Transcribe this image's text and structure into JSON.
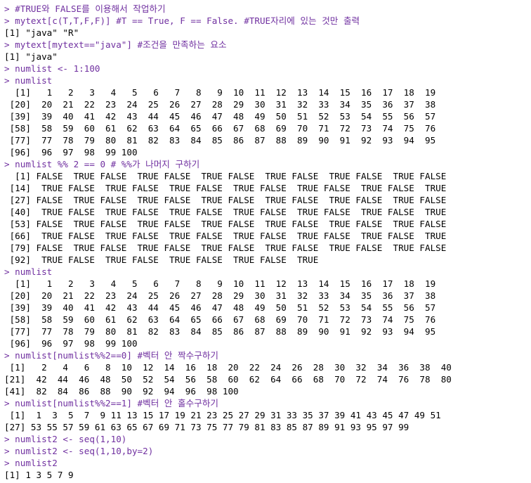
{
  "colors": {
    "input": "#7030a0",
    "output": "#000000",
    "background": "#ffffff"
  },
  "console": {
    "lines": [
      {
        "type": "input",
        "text": "> #TRUE와 FALSE를 이용해서 작업하기"
      },
      {
        "type": "input",
        "text": "> mytext[c(T,T,F,F)] #T == True, F == False. #TRUE자리에 있는 것만 출력"
      },
      {
        "type": "output",
        "text": "[1] \"java\" \"R\""
      },
      {
        "type": "input",
        "text": "> mytext[mytext==\"java\"] #조건을 만족하는 요소"
      },
      {
        "type": "output",
        "text": "[1] \"java\""
      },
      {
        "type": "input",
        "text": "> numlist <- 1:100"
      },
      {
        "type": "input",
        "text": "> numlist"
      },
      {
        "type": "output",
        "text": "  [1]   1   2   3   4   5   6   7   8   9  10  11  12  13  14  15  16  17  18  19"
      },
      {
        "type": "output",
        "text": " [20]  20  21  22  23  24  25  26  27  28  29  30  31  32  33  34  35  36  37  38"
      },
      {
        "type": "output",
        "text": " [39]  39  40  41  42  43  44  45  46  47  48  49  50  51  52  53  54  55  56  57"
      },
      {
        "type": "output",
        "text": " [58]  58  59  60  61  62  63  64  65  66  67  68  69  70  71  72  73  74  75  76"
      },
      {
        "type": "output",
        "text": " [77]  77  78  79  80  81  82  83  84  85  86  87  88  89  90  91  92  93  94  95"
      },
      {
        "type": "output",
        "text": " [96]  96  97  98  99 100"
      },
      {
        "type": "input",
        "text": "> numlist %% 2 == 0 # %%가 나머지 구하기"
      },
      {
        "type": "output",
        "text": "  [1] FALSE  TRUE FALSE  TRUE FALSE  TRUE FALSE  TRUE FALSE  TRUE FALSE  TRUE FALSE"
      },
      {
        "type": "output",
        "text": " [14]  TRUE FALSE  TRUE FALSE  TRUE FALSE  TRUE FALSE  TRUE FALSE  TRUE FALSE  TRUE"
      },
      {
        "type": "output",
        "text": " [27] FALSE  TRUE FALSE  TRUE FALSE  TRUE FALSE  TRUE FALSE  TRUE FALSE  TRUE FALSE"
      },
      {
        "type": "output",
        "text": " [40]  TRUE FALSE  TRUE FALSE  TRUE FALSE  TRUE FALSE  TRUE FALSE  TRUE FALSE  TRUE"
      },
      {
        "type": "output",
        "text": " [53] FALSE  TRUE FALSE  TRUE FALSE  TRUE FALSE  TRUE FALSE  TRUE FALSE  TRUE FALSE"
      },
      {
        "type": "output",
        "text": " [66]  TRUE FALSE  TRUE FALSE  TRUE FALSE  TRUE FALSE  TRUE FALSE  TRUE FALSE  TRUE"
      },
      {
        "type": "output",
        "text": " [79] FALSE  TRUE FALSE  TRUE FALSE  TRUE FALSE  TRUE FALSE  TRUE FALSE  TRUE FALSE"
      },
      {
        "type": "output",
        "text": " [92]  TRUE FALSE  TRUE FALSE  TRUE FALSE  TRUE FALSE  TRUE"
      },
      {
        "type": "input",
        "text": "> numlist"
      },
      {
        "type": "output",
        "text": "  [1]   1   2   3   4   5   6   7   8   9  10  11  12  13  14  15  16  17  18  19"
      },
      {
        "type": "output",
        "text": " [20]  20  21  22  23  24  25  26  27  28  29  30  31  32  33  34  35  36  37  38"
      },
      {
        "type": "output",
        "text": " [39]  39  40  41  42  43  44  45  46  47  48  49  50  51  52  53  54  55  56  57"
      },
      {
        "type": "output",
        "text": " [58]  58  59  60  61  62  63  64  65  66  67  68  69  70  71  72  73  74  75  76"
      },
      {
        "type": "output",
        "text": " [77]  77  78  79  80  81  82  83  84  85  86  87  88  89  90  91  92  93  94  95"
      },
      {
        "type": "output",
        "text": " [96]  96  97  98  99 100"
      },
      {
        "type": "input",
        "text": "> numlist[numlist%%2==0] #벡터 안 짝수구하기"
      },
      {
        "type": "output",
        "text": " [1]   2   4   6   8  10  12  14  16  18  20  22  24  26  28  30  32  34  36  38  40"
      },
      {
        "type": "output",
        "text": "[21]  42  44  46  48  50  52  54  56  58  60  62  64  66  68  70  72  74  76  78  80"
      },
      {
        "type": "output",
        "text": "[41]  82  84  86  88  90  92  94  96  98 100"
      },
      {
        "type": "input",
        "text": "> numlist[numlist%%2==1] #벡터 안 홀수구하기"
      },
      {
        "type": "output",
        "text": " [1]  1  3  5  7  9 11 13 15 17 19 21 23 25 27 29 31 33 35 37 39 41 43 45 47 49 51"
      },
      {
        "type": "output",
        "text": "[27] 53 55 57 59 61 63 65 67 69 71 73 75 77 79 81 83 85 87 89 91 93 95 97 99"
      },
      {
        "type": "input",
        "text": "> numlist2 <- seq(1,10)"
      },
      {
        "type": "input",
        "text": "> numlist2 <- seq(1,10,by=2)"
      },
      {
        "type": "input",
        "text": "> numlist2"
      },
      {
        "type": "output",
        "text": "[1] 1 3 5 7 9"
      }
    ]
  }
}
